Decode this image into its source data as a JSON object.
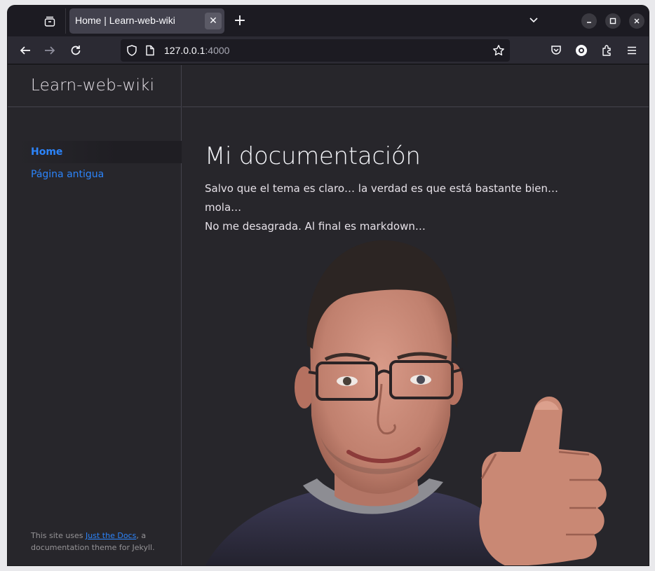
{
  "browser": {
    "tab": {
      "title": "Home | Learn-web-wiki"
    },
    "url": {
      "host": "127.0.0.1",
      "port": ":4000"
    },
    "icons": [
      "tab-list-icon",
      "close-icon",
      "new-tab-icon",
      "list-all-tabs-icon",
      "minimize-icon",
      "maximize-icon",
      "close-window-icon",
      "back-icon",
      "forward-icon",
      "reload-icon",
      "shield-icon",
      "page-icon",
      "star-icon",
      "pocket-icon",
      "account-icon",
      "extensions-icon",
      "menu-icon"
    ]
  },
  "site": {
    "title": "Learn-web-wiki",
    "nav": [
      {
        "label": "Home",
        "active": true
      },
      {
        "label": "Página antigua",
        "active": false
      }
    ],
    "footer": {
      "prefix": "This site uses ",
      "link": "Just the Docs",
      "suffix": ", a documentation theme for Jekyll."
    }
  },
  "content": {
    "heading": "Mi documentación",
    "line1": "Salvo que el tema es claro… la verdad es que está bastante bien… mola…",
    "line2": "No me desagrada. Al final es markdown…"
  },
  "colors": {
    "page_bg": "#27262b",
    "link": "#2c84fa",
    "heading": "#f5f6fa",
    "text": "#e6e1e8"
  }
}
